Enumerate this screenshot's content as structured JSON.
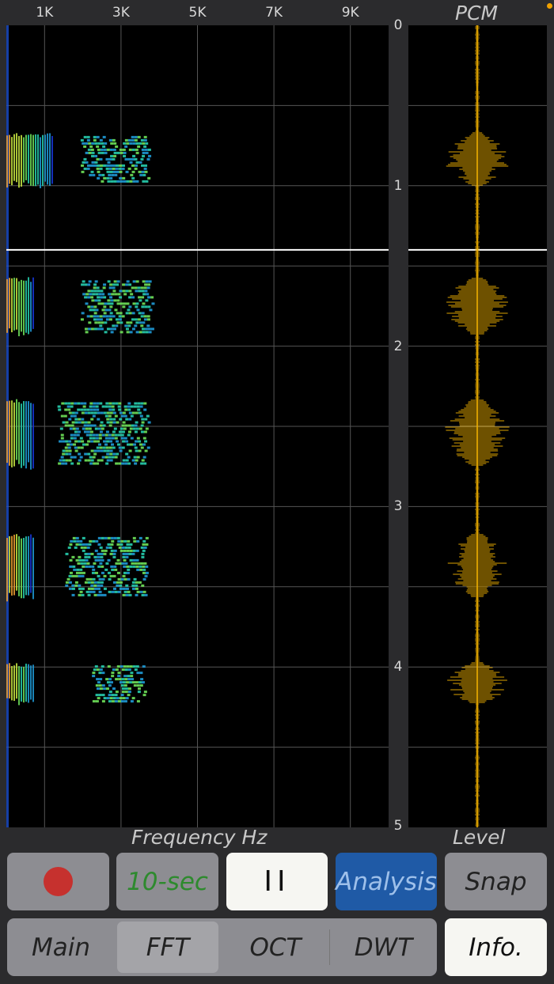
{
  "frequency_axis": {
    "ticks": [
      {
        "label": "1K",
        "hz": 1000
      },
      {
        "label": "3K",
        "hz": 3000
      },
      {
        "label": "5K",
        "hz": 5000
      },
      {
        "label": "7K",
        "hz": 7000
      },
      {
        "label": "9K",
        "hz": 9000
      }
    ],
    "title": "Frequency Hz",
    "max_hz": 10000
  },
  "time_axis": {
    "ticks": [
      "0",
      "1",
      "2",
      "3",
      "4",
      "5"
    ],
    "max_seconds": 5,
    "cursor_seconds": 1.4
  },
  "pcm_panel": {
    "title": "PCM",
    "bottom_label": "Level"
  },
  "spectrogram_events": [
    {
      "start": 0.67,
      "end": 1.0,
      "low_band_max_hz": 1200,
      "high_band": [
        2000,
        3700
      ]
    },
    {
      "start": 1.57,
      "end": 1.93,
      "low_band_max_hz": 700,
      "high_band": [
        2000,
        3800
      ]
    },
    {
      "start": 2.33,
      "end": 2.75,
      "low_band_max_hz": 700,
      "high_band": [
        1400,
        3700
      ]
    },
    {
      "start": 3.17,
      "end": 3.57,
      "low_band_max_hz": 700,
      "high_band": [
        1600,
        3600
      ]
    },
    {
      "start": 3.97,
      "end": 4.23,
      "low_band_max_hz": 700,
      "high_band": [
        2300,
        3600
      ]
    }
  ],
  "controls": {
    "record_label": "",
    "duration_label": "10-sec",
    "pause_label": "II",
    "analysis_label": "Analysis",
    "snap_label": "Snap",
    "tabs": [
      "Main",
      "FFT",
      "OCT",
      "DWT"
    ],
    "selected_tab": "FFT",
    "info_label": "Info."
  },
  "colors": {
    "analysis_bg": "#1f5aa6",
    "record_red": "#c6312e",
    "pcm_wave": "#f5b400",
    "status_dot": "#f0a000"
  }
}
